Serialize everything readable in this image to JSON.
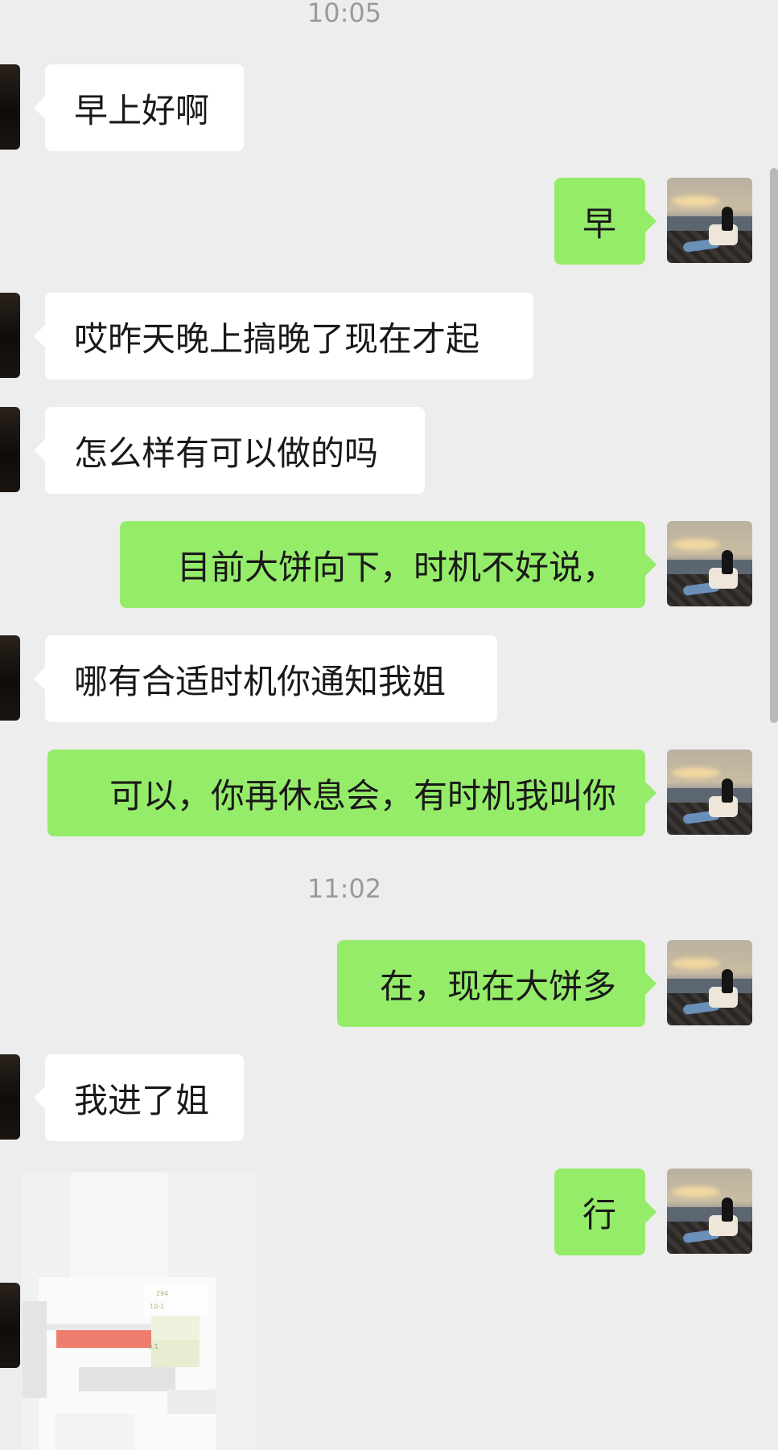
{
  "timestamps": [
    "10:05",
    "11:02"
  ],
  "messages": [
    {
      "side": "left",
      "text": "早上好啊"
    },
    {
      "side": "right",
      "text": "早"
    },
    {
      "side": "left",
      "text": "哎昨天晚上搞晚了现在才起"
    },
    {
      "side": "left",
      "text": "怎么样有可以做的吗"
    },
    {
      "side": "right",
      "text": "目前大饼向下，时机不好说，"
    },
    {
      "side": "left",
      "text": "哪有合适时机你通知我姐"
    },
    {
      "side": "right",
      "text": "可以，你再休息会，有时机我叫你"
    },
    {
      "side": "right",
      "text": "在，现在大饼多"
    },
    {
      "side": "left",
      "text": "我进了姐"
    },
    {
      "side": "right",
      "text": "行"
    }
  ],
  "image_message": {
    "visible_fragments": [
      "294",
      "10-1",
      "0.1"
    ]
  },
  "colors": {
    "background": "#ededed",
    "sent_bubble": "#95ec69",
    "received_bubble": "#ffffff",
    "timestamp_text": "#9a9a9a",
    "message_text": "#191919"
  }
}
